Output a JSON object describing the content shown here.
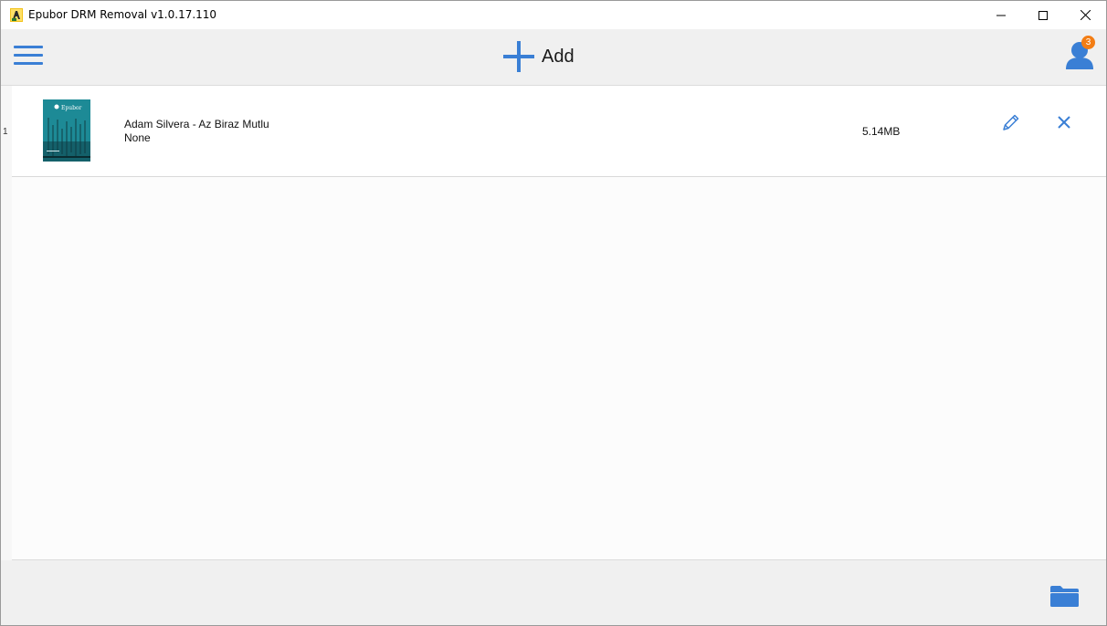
{
  "window": {
    "title": "Epubor DRM Removal v1.0.17.110",
    "controls": {
      "minimize": "minimize-icon",
      "maximize": "maximize-icon",
      "close": "close-icon"
    }
  },
  "toolbar": {
    "menu_icon": "hamburger-menu-icon",
    "add_label": "Add",
    "add_icon": "plus-icon",
    "user_icon": "user-icon",
    "notification_count": "3"
  },
  "books": [
    {
      "index": "1",
      "title": "Adam Silvera - Az Biraz Mutlu",
      "drm": "None",
      "size": "5.14MB",
      "cover_brand": "Epubor"
    }
  ],
  "footer": {
    "folder_icon": "folder-icon"
  },
  "colors": {
    "accent": "#3a7fd5",
    "badge": "#f37d14",
    "toolbar_bg": "#f0f0f0",
    "content_bg": "#fcfcfc",
    "cover_bg": "#1d8a96"
  }
}
